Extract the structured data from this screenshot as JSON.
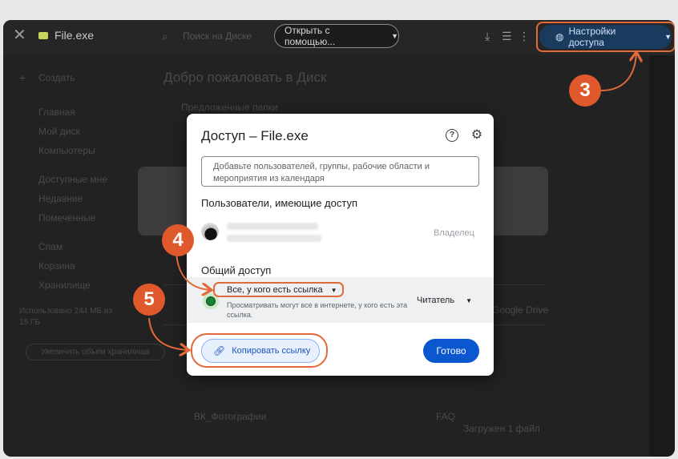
{
  "window": {
    "file_name": "File.exe",
    "open_with_label": "Открыть с помощью...",
    "share_button_label": "Настройки доступа"
  },
  "background": {
    "search_placeholder": "Поиск на Диске",
    "welcome": "Добро пожаловать в Диск",
    "new_label": "Создать",
    "nav": [
      "Главная",
      "Мой диск",
      "Компьютеры",
      "Доступные мне",
      "Недавние",
      "Помеченные",
      "Спам",
      "Корзина",
      "Хранилище"
    ],
    "section_folders": "Предложенные папки",
    "storage_text_1": "Использовано 244 МБ из",
    "storage_text_2": "15 ГБ",
    "storage_button": "Увеличить объем хранилища",
    "right_text_1": "Google Drive",
    "upload_status": "Загружен 1 файл",
    "row_label": "ВК_Фотографии",
    "row_label_2": "FAQ"
  },
  "dialog": {
    "title": "Доступ – File.exe",
    "add_placeholder": "Добавьте пользователей, группы, рабочие области и мероприятия из календаря",
    "people_heading": "Пользователи, имеющие доступ",
    "owner_label": "Владелец",
    "general_heading": "Общий доступ",
    "access_option": "Все, у кого есть ссылка",
    "access_description": "Просматривать могут все в интернете, у кого есть эта ссылка.",
    "role_label": "Читатель",
    "copy_link_label": "Копировать ссылку",
    "done_label": "Готово"
  },
  "annotations": {
    "step3": "3",
    "step4": "4",
    "step5": "5"
  },
  "colors": {
    "accent": "#0b57d0",
    "annotation": "#e0592c"
  }
}
